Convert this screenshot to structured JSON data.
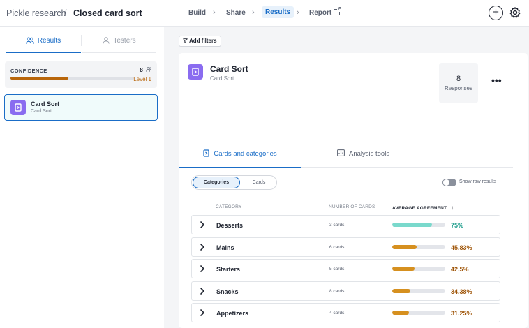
{
  "header": {
    "project": "Pickle research",
    "separator": "/",
    "page_title": "Closed card sort",
    "nav": [
      {
        "label": "Build",
        "active": false
      },
      {
        "label": "Share",
        "active": false
      },
      {
        "label": "Results",
        "active": true
      },
      {
        "label": "Report",
        "active": false
      }
    ],
    "actions": [
      "plus-icon",
      "gear-icon"
    ]
  },
  "sidebar": {
    "tabs": [
      {
        "label": "Results",
        "icon": "people-icon",
        "active": true
      },
      {
        "label": "Testers",
        "icon": "person-icon",
        "active": false
      }
    ],
    "confidence": {
      "label": "CONFIDENCE",
      "count": "8",
      "level": "Level 1",
      "progress": 0.47,
      "color": "#b8650a"
    },
    "study": {
      "title": "Card Sort",
      "subtitle": "Card Sort"
    }
  },
  "main": {
    "add_filters_label": "Add filters",
    "study": {
      "title": "Card Sort",
      "subtitle": "Card Sort",
      "responses_count": "8",
      "responses_label": "Responses"
    },
    "tabs": [
      {
        "label": "Cards and categories",
        "icon": "cards-icon",
        "active": true
      },
      {
        "label": "Analysis tools",
        "icon": "chart-icon",
        "active": false
      }
    ],
    "view_toggle": {
      "categories_label": "Categories",
      "cards_label": "Cards",
      "selected": "Categories"
    },
    "raw_results": {
      "label": "Show raw results",
      "enabled": false
    },
    "table": {
      "headers": {
        "category": "CATEGORY",
        "count": "NUMBER OF CARDS",
        "agreement": "AVERAGE AGREEMENT"
      },
      "sort_indicator": "↓",
      "rows": [
        {
          "name": "Desserts",
          "count": "3 cards",
          "agreement": "75%",
          "value": 0.75,
          "color": "#7ad9cc",
          "text_color": "#1a9c8a"
        },
        {
          "name": "Mains",
          "count": "6 cards",
          "agreement": "45.83%",
          "value": 0.4583,
          "color": "#d6901f",
          "text_color": "#a0570b"
        },
        {
          "name": "Starters",
          "count": "5 cards",
          "agreement": "42.5%",
          "value": 0.425,
          "color": "#d6901f",
          "text_color": "#a0570b"
        },
        {
          "name": "Snacks",
          "count": "8 cards",
          "agreement": "34.38%",
          "value": 0.3438,
          "color": "#d6901f",
          "text_color": "#a0570b"
        },
        {
          "name": "Appetizers",
          "count": "4 cards",
          "agreement": "31.25%",
          "value": 0.3125,
          "color": "#d6901f",
          "text_color": "#a0570b"
        }
      ]
    }
  },
  "colors": {
    "accent": "#1a6dc7",
    "study_icon": "#8a6cf0"
  }
}
